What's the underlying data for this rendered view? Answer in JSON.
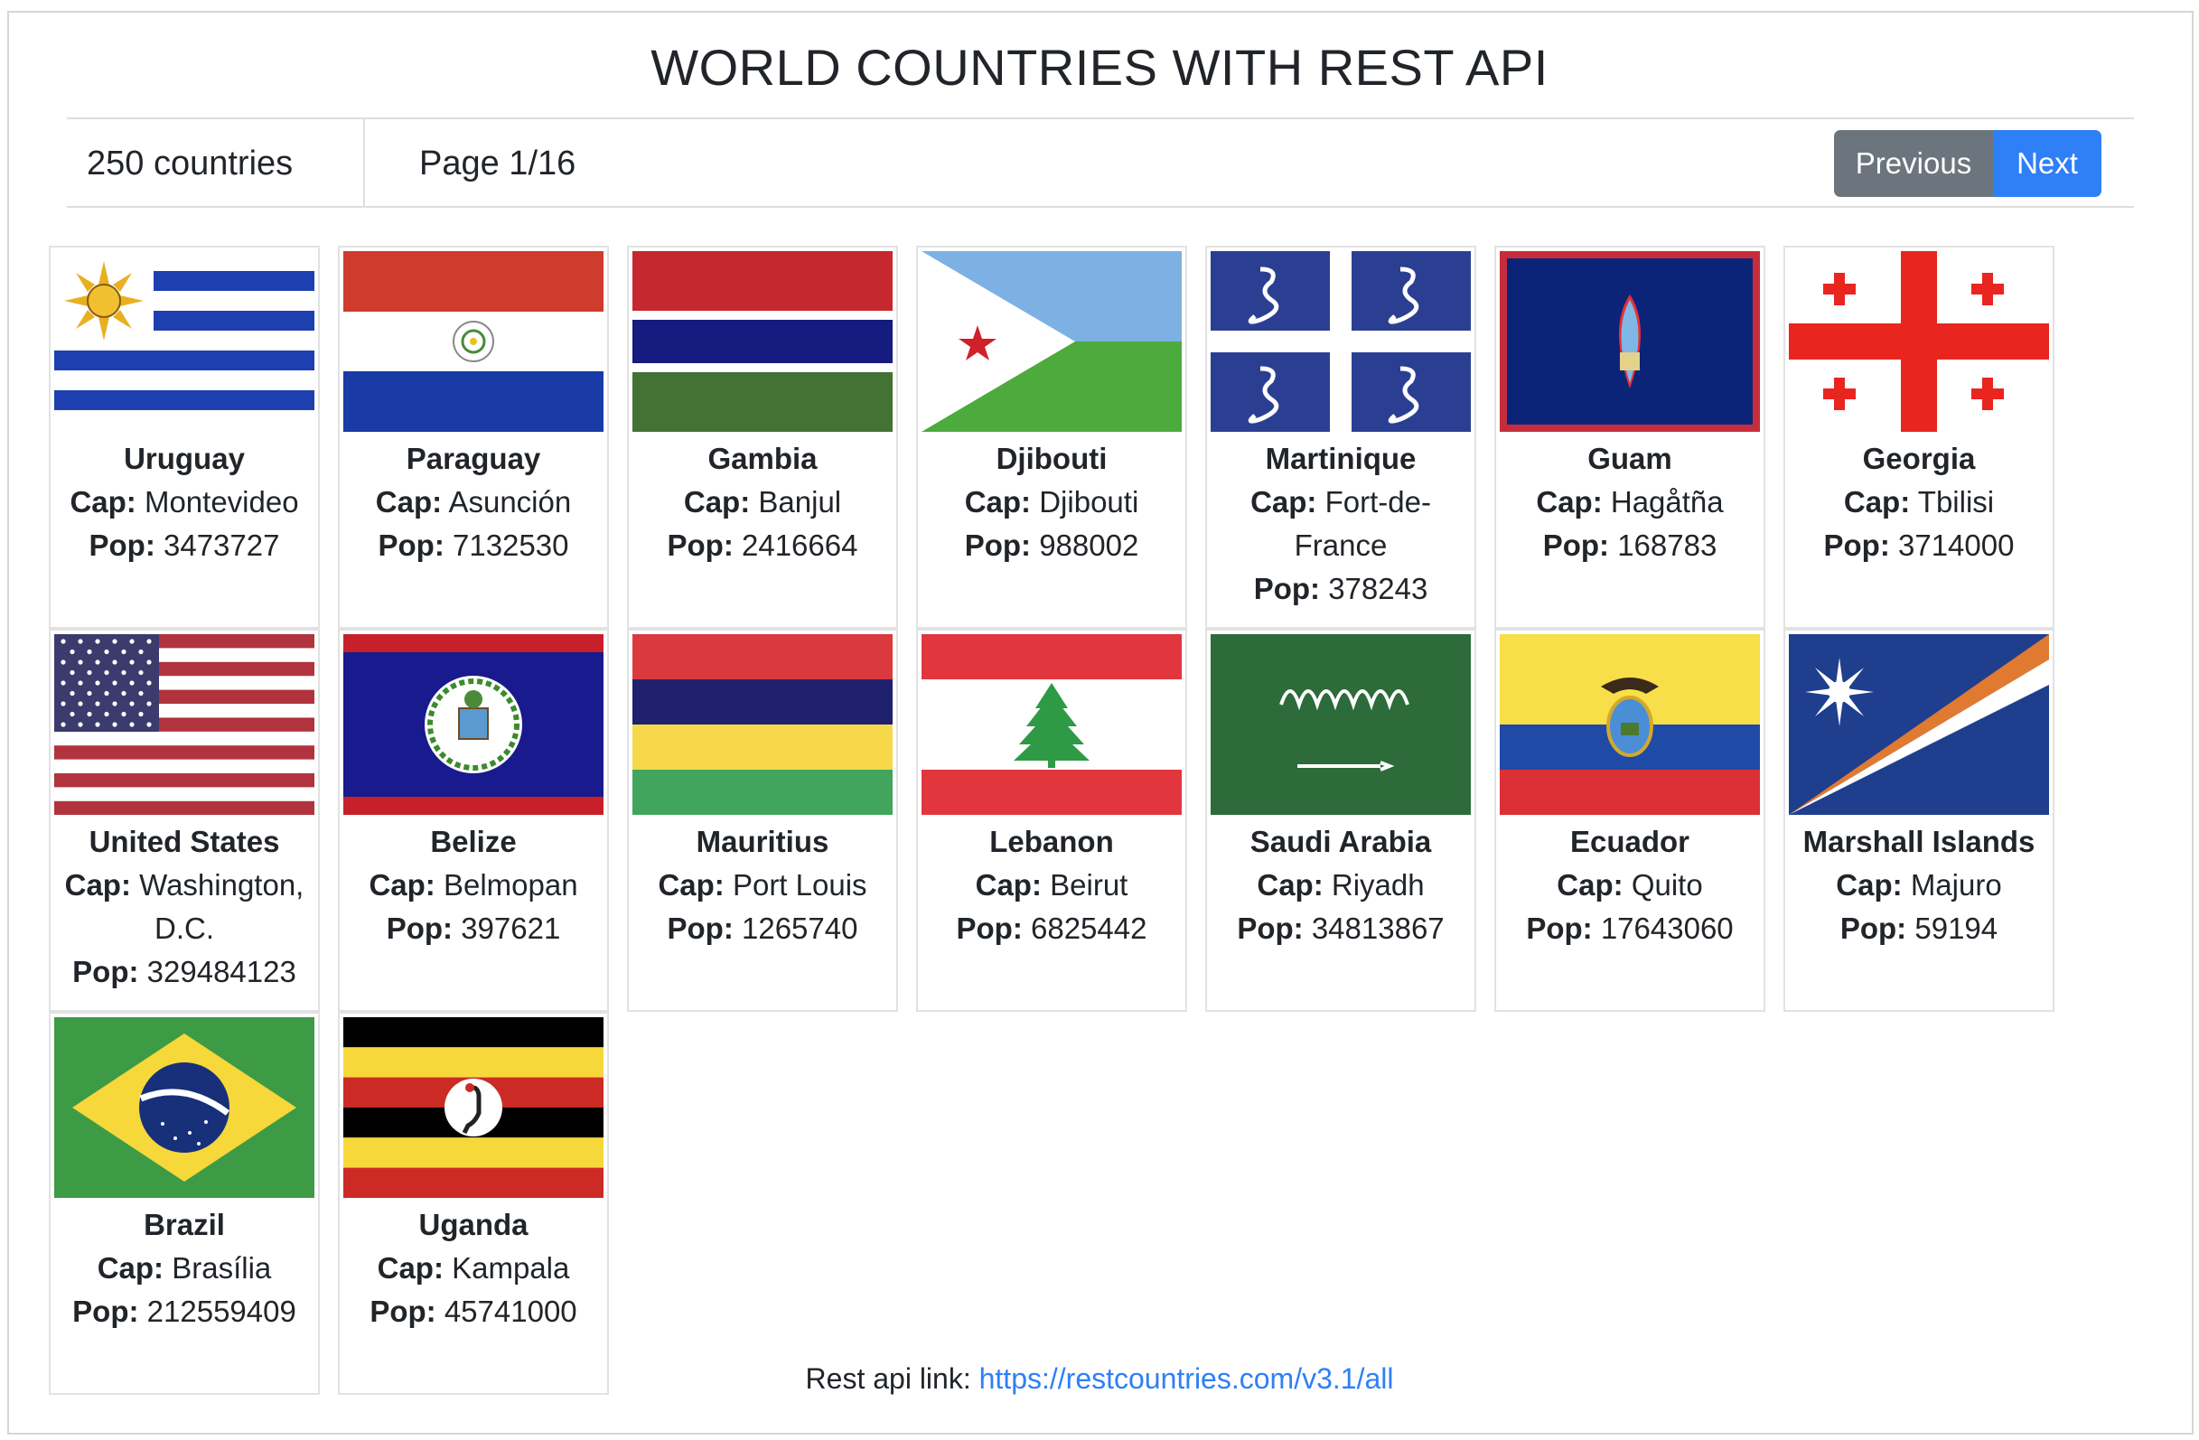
{
  "title": "WORLD COUNTRIES WITH REST API",
  "toolbar": {
    "count_label": "250 countries",
    "page_label": "Page 1/16",
    "prev_label": "Previous",
    "next_label": "Next"
  },
  "labels": {
    "cap": "Cap:",
    "pop": "Pop:"
  },
  "countries": [
    {
      "name": "Uruguay",
      "capital": "Montevideo",
      "population": "3473727",
      "flag": "uruguay-flag"
    },
    {
      "name": "Paraguay",
      "capital": "Asunción",
      "population": "7132530",
      "flag": "paraguay-flag"
    },
    {
      "name": "Gambia",
      "capital": "Banjul",
      "population": "2416664",
      "flag": "gambia-flag"
    },
    {
      "name": "Djibouti",
      "capital": "Djibouti",
      "population": "988002",
      "flag": "djibouti-flag"
    },
    {
      "name": "Martinique",
      "capital": "Fort-de-France",
      "population": "378243",
      "flag": "martinique-flag"
    },
    {
      "name": "Guam",
      "capital": "Hagåtña",
      "population": "168783",
      "flag": "guam-flag"
    },
    {
      "name": "Georgia",
      "capital": "Tbilisi",
      "population": "3714000",
      "flag": "georgia-flag"
    },
    {
      "name": "United States",
      "capital": "Washington, D.C.",
      "population": "329484123",
      "flag": "united-states-flag"
    },
    {
      "name": "Belize",
      "capital": "Belmopan",
      "population": "397621",
      "flag": "belize-flag"
    },
    {
      "name": "Mauritius",
      "capital": "Port Louis",
      "population": "1265740",
      "flag": "mauritius-flag"
    },
    {
      "name": "Lebanon",
      "capital": "Beirut",
      "population": "6825442",
      "flag": "lebanon-flag"
    },
    {
      "name": "Saudi Arabia",
      "capital": "Riyadh",
      "population": "34813867",
      "flag": "saudi-arabia-flag"
    },
    {
      "name": "Ecuador",
      "capital": "Quito",
      "population": "17643060",
      "flag": "ecuador-flag"
    },
    {
      "name": "Marshall Islands",
      "capital": "Majuro",
      "population": "59194",
      "flag": "marshall-islands-flag"
    },
    {
      "name": "Brazil",
      "capital": "Brasília",
      "population": "212559409",
      "flag": "brazil-flag"
    },
    {
      "name": "Uganda",
      "capital": "Kampala",
      "population": "45741000",
      "flag": "uganda-flag"
    }
  ],
  "footer": {
    "label": "Rest api link:",
    "link_text": "https://restcountries.com/v3.1/all"
  }
}
